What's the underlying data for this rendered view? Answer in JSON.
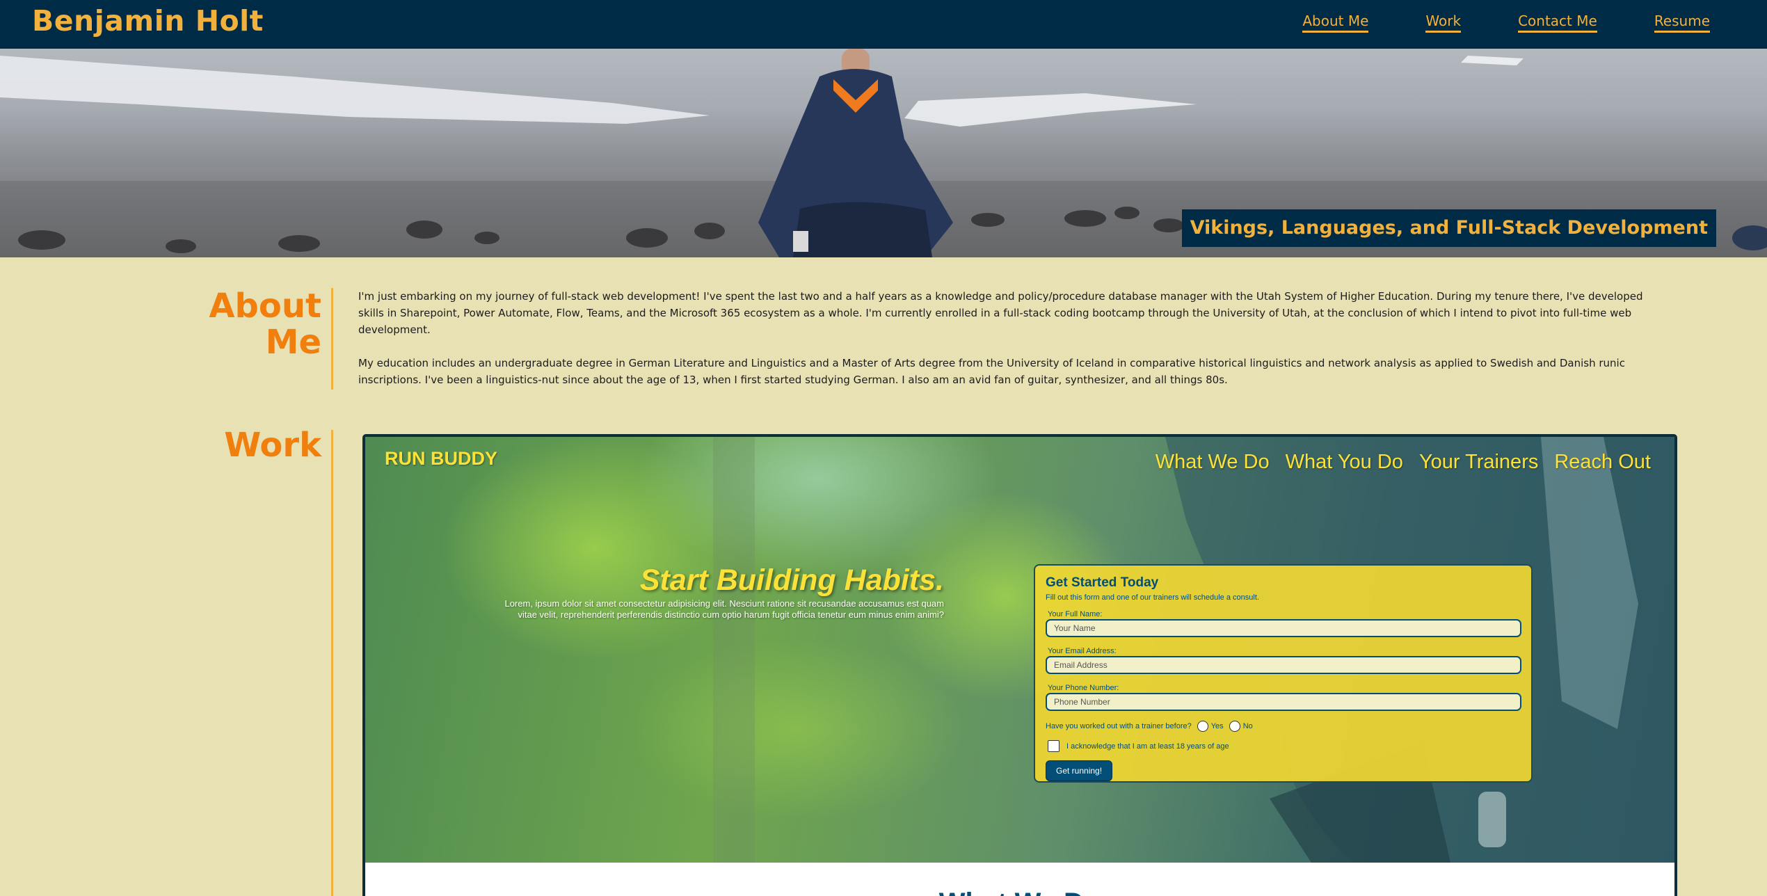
{
  "header": {
    "site_name": "Benjamin Holt",
    "nav": [
      "About Me",
      "Work",
      "Contact Me",
      "Resume"
    ]
  },
  "hero": {
    "tagline": "Vikings, Languages, and Full-Stack Development"
  },
  "about": {
    "title_line1": "About",
    "title_line2": "Me",
    "paragraph1": "I'm just embarking on my journey of full-stack web development! I've spent the last two and a half years as a knowledge and policy/procedure database manager with the Utah System of Higher Education. During my tenure there, I've developed skills in Sharepoint, Power Automate, Flow, Teams, and the Microsoft 365 ecosystem as a whole. I'm currently enrolled in a full-stack coding bootcamp through the University of Utah, at the conclusion of which I intend to pivot into full-time web development.",
    "paragraph2": "My education includes an undergraduate degree in German Literature and Linguistics and a Master of Arts degree from the University of Iceland in comparative historical linguistics and network analysis as applied to Swedish and Danish runic inscriptions. I've been a linguistics-nut since about the age of 13, when I first started studying German. I also am an avid fan of guitar, synthesizer, and all things 80s."
  },
  "work": {
    "title": "Work",
    "project": {
      "logo": "RUN BUDDY",
      "nav": [
        "What We Do",
        "What You Do",
        "Your Trainers",
        "Reach Out"
      ],
      "headline": "Start Building Habits.",
      "lorem": "Lorem, ipsum dolor sit amet consectetur adipisicing elit. Nesciunt ratione sit recusandae accusamus est quam vitae velit, reprehenderit perferendis distinctio cum optio harum fugit officia tenetur eum minus enim animi?",
      "form": {
        "title": "Get Started Today",
        "subtitle": "Fill out this form and one of our trainers will schedule a consult.",
        "name_label": "Your Full Name:",
        "name_placeholder": "Your Name",
        "email_label": "Your Email Address:",
        "email_placeholder": "Email Address",
        "phone_label": "Your Phone Number:",
        "phone_placeholder": "Phone Number",
        "trainer_question": "Have you worked out with a trainer before?",
        "yes": "Yes",
        "no": "No",
        "age_ack": "I acknowledge that I am at least 18 years of age",
        "submit": "Get running!"
      },
      "next_section_title": "What We Do"
    }
  }
}
